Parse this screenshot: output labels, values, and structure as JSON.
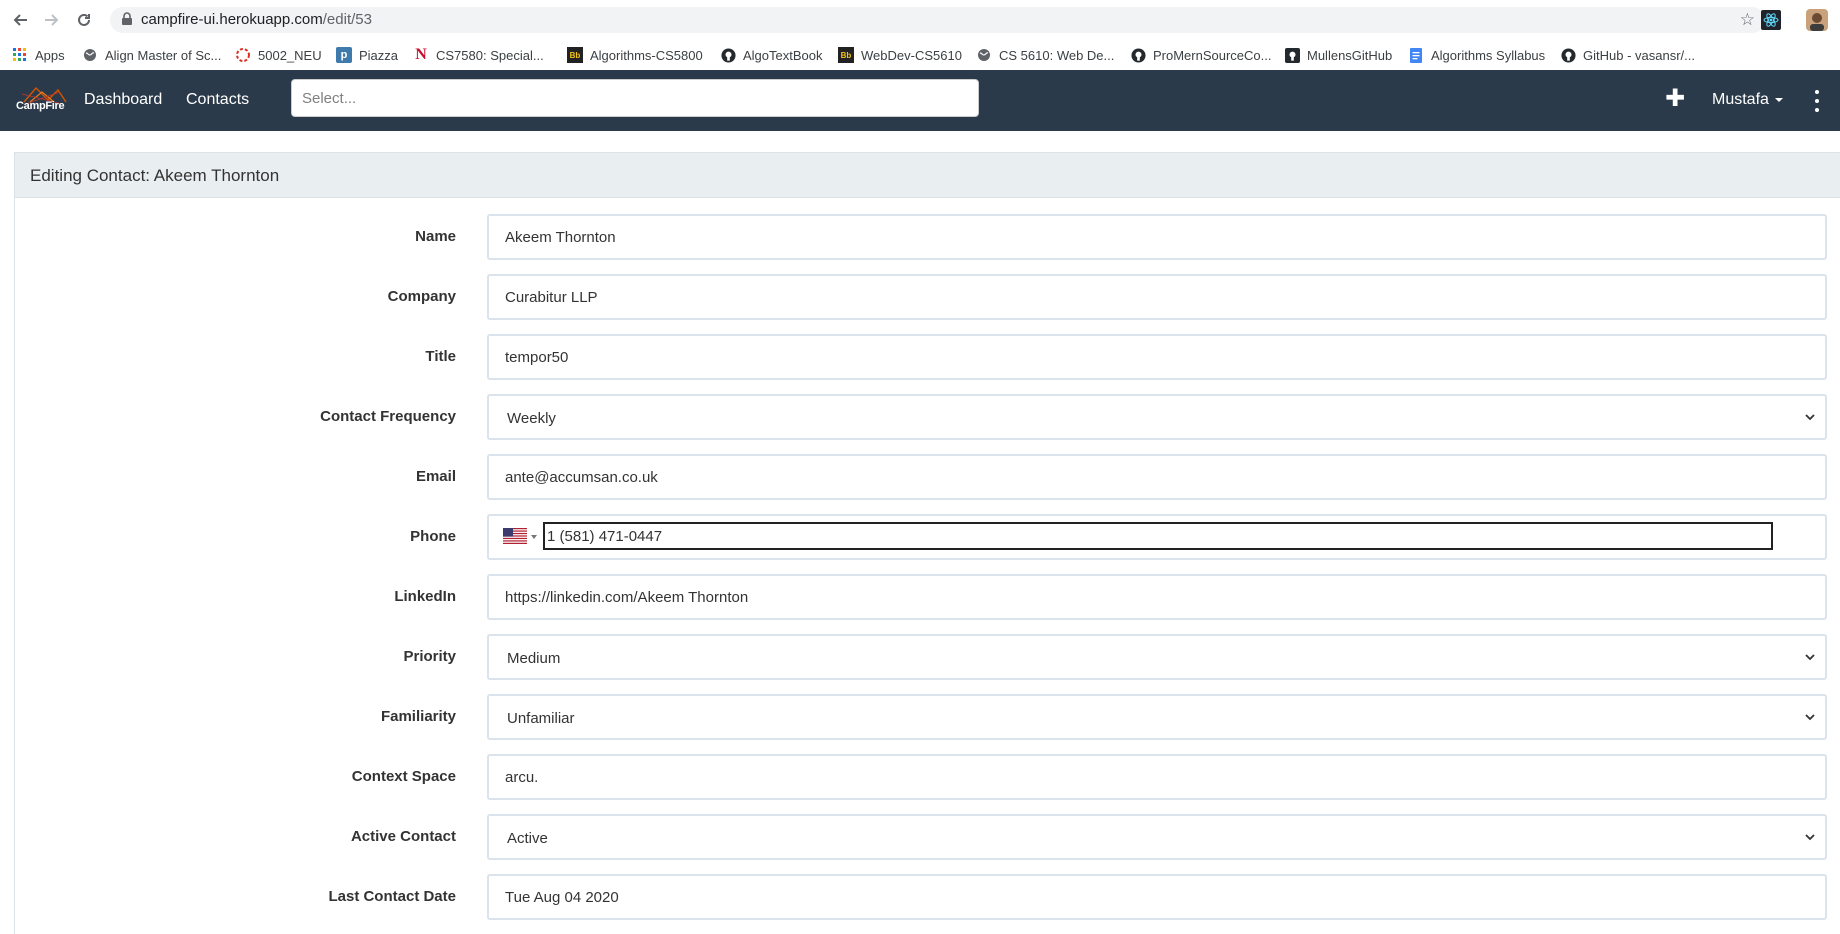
{
  "browser": {
    "url_host": "campfire-ui.herokuapp.com",
    "url_path": "/edit/53",
    "bookmarks": [
      {
        "label": "Apps",
        "icon": "apps-grid-icon"
      },
      {
        "label": "Align Master of Sc...",
        "icon": "globe-icon"
      },
      {
        "label": "5002_NEU",
        "icon": "ring-icon"
      },
      {
        "label": "Piazza",
        "icon": "piazza-icon"
      },
      {
        "label": "CS7580: Special...",
        "icon": "northeastern-icon"
      },
      {
        "label": "Algorithms-CS5800",
        "icon": "blackboard-icon"
      },
      {
        "label": "AlgoTextBook",
        "icon": "github-icon"
      },
      {
        "label": "WebDev-CS5610",
        "icon": "blackboard-icon"
      },
      {
        "label": "CS 5610: Web De...",
        "icon": "globe-icon"
      },
      {
        "label": "ProMernSourceCo...",
        "icon": "github-icon"
      },
      {
        "label": "MullensGitHub",
        "icon": "github-icon"
      },
      {
        "label": "Algorithms Syllabus",
        "icon": "doc-icon"
      },
      {
        "label": "GitHub - vasansr/...",
        "icon": "github-icon"
      }
    ]
  },
  "navbar": {
    "brand": "CampFire",
    "links": [
      "Dashboard",
      "Contacts"
    ],
    "search_placeholder": "Select...",
    "user": "Mustafa"
  },
  "form": {
    "heading": "Editing Contact: Akeem Thornton",
    "fields": [
      {
        "label": "Name",
        "value": "Akeem Thornton",
        "type": "text"
      },
      {
        "label": "Company",
        "value": "Curabitur LLP",
        "type": "text"
      },
      {
        "label": "Title",
        "value": "tempor50",
        "type": "text"
      },
      {
        "label": "Contact Frequency",
        "value": "Weekly",
        "type": "select"
      },
      {
        "label": "Email",
        "value": "ante@accumsan.co.uk",
        "type": "text"
      },
      {
        "label": "Phone",
        "value": "1 (581) 471-0447",
        "type": "phone"
      },
      {
        "label": "LinkedIn",
        "value": "https://linkedin.com/Akeem Thornton",
        "type": "text"
      },
      {
        "label": "Priority",
        "value": "Medium",
        "type": "select"
      },
      {
        "label": "Familiarity",
        "value": "Unfamiliar",
        "type": "select"
      },
      {
        "label": "Context Space",
        "value": "arcu.",
        "type": "text"
      },
      {
        "label": "Active Contact",
        "value": "Active",
        "type": "select"
      },
      {
        "label": "Last Contact Date",
        "value": "Tue Aug 04 2020",
        "type": "text"
      }
    ]
  },
  "colors": {
    "navbar_bg": "#2b3a4a",
    "panel_head_bg": "#e9eef0",
    "input_border": "#dbe3ec"
  }
}
